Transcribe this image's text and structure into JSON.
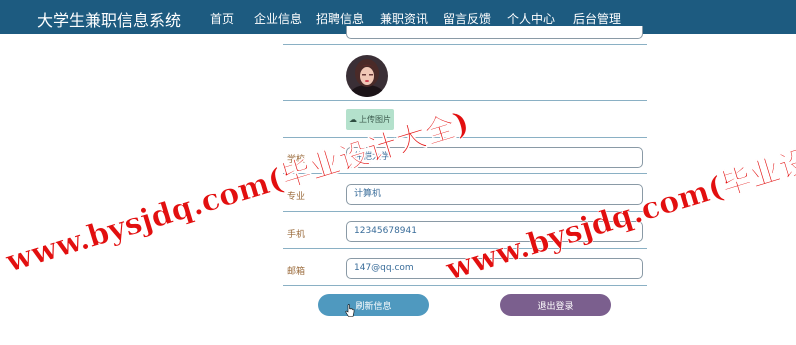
{
  "header": {
    "brand": "大学生兼职信息系统",
    "nav": [
      {
        "label": "首页",
        "active": false
      },
      {
        "label": "企业信息",
        "active": false
      },
      {
        "label": "招聘信息",
        "active": false
      },
      {
        "label": "兼职资讯",
        "active": false
      },
      {
        "label": "留言反馈",
        "active": false
      },
      {
        "label": "个人中心",
        "active": true
      },
      {
        "label": "后台管理",
        "active": false
      }
    ]
  },
  "form": {
    "upload_label": "上传图片",
    "fields": [
      {
        "label": "学校",
        "value": "仲恺大学"
      },
      {
        "label": "专业",
        "value": "计算机"
      },
      {
        "label": "手机",
        "value": "12345678941"
      },
      {
        "label": "邮箱",
        "value": "147@qq.com"
      }
    ],
    "refresh_label": "刷新信息",
    "logout_label": "退出登录"
  },
  "watermark": {
    "line1": "www.bysjdq.com(毕业设计大全)",
    "line2": "www.bysjdq.com(毕业设计大全)"
  },
  "colors": {
    "header_bg": "#1d5b80",
    "refresh_button": "#4f99bf",
    "logout_button": "#7b5f8e",
    "upload_button": "#b4e1cc",
    "watermark": "#e20f0f"
  }
}
